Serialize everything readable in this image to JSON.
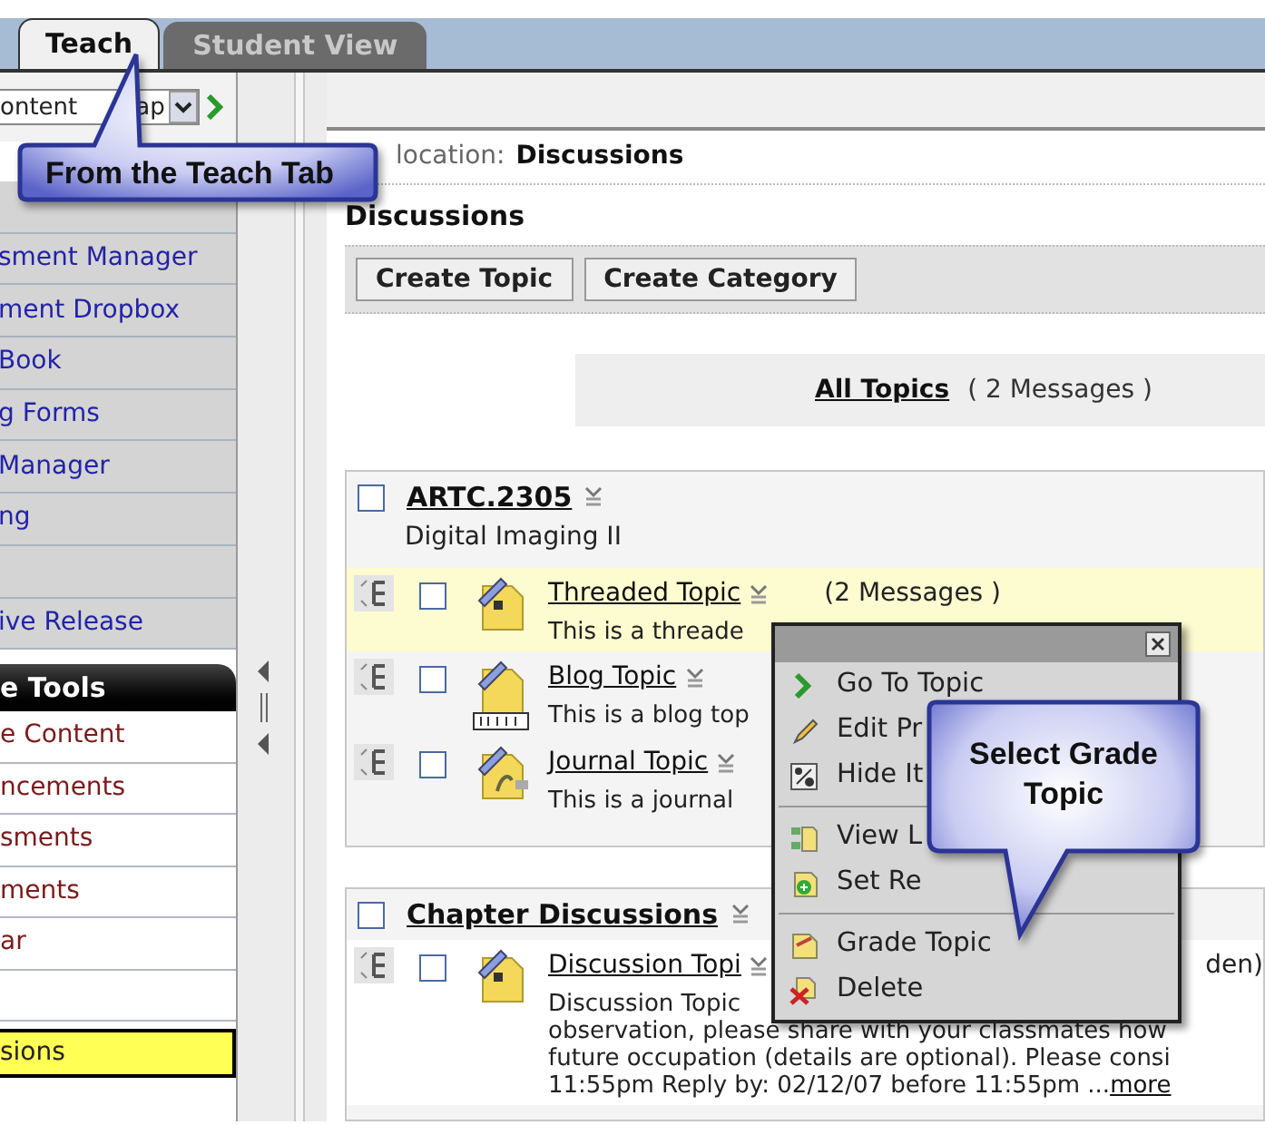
{
  "tabs": [
    {
      "label": "Teach",
      "selected": true
    },
    {
      "label": "Student View",
      "selected": false
    }
  ],
  "course_select": {
    "value_left": "ontent",
    "value_right": "ap"
  },
  "sidebar": {
    "items": [
      {
        "kind": "blank"
      },
      {
        "kind": "link",
        "label": "sment Manager"
      },
      {
        "kind": "link",
        "label": "ment Dropbox"
      },
      {
        "kind": "link",
        "label": "Book"
      },
      {
        "kind": "link",
        "label": "g Forms"
      },
      {
        "kind": "link",
        "label": "Manager"
      },
      {
        "kind": "link",
        "label": "ng"
      },
      {
        "kind": "blank"
      },
      {
        "kind": "link",
        "label": "ive Release"
      }
    ],
    "tools_header": "e Tools",
    "tools": [
      {
        "kind": "link",
        "label": "e Content",
        "selected": false
      },
      {
        "kind": "link",
        "label": "ncements",
        "selected": false
      },
      {
        "kind": "link",
        "label": "sments",
        "selected": false
      },
      {
        "kind": "link",
        "label": "ments",
        "selected": false
      },
      {
        "kind": "link",
        "label": "ar",
        "selected": false
      },
      {
        "kind": "blank",
        "selected": false
      },
      {
        "kind": "link",
        "label": "sions",
        "selected": true
      }
    ]
  },
  "location": {
    "label": "location:",
    "value": "Discussions"
  },
  "heading": "Discussions",
  "toolbar": [
    "Create Topic",
    "Create Category"
  ],
  "all_topics": {
    "link": "All Topics",
    "count": "( 2 Messages )"
  },
  "categories": [
    {
      "title": "ARTC.2305",
      "checked": false,
      "subtitle": "Digital Imaging II",
      "topics": [
        {
          "kind": "thread",
          "title": "Threaded Topic",
          "checked": false,
          "messages": "(2 Messages )",
          "highlighted": true,
          "description": [
            "This is a threade"
          ]
        },
        {
          "kind": "blog",
          "title": "Blog Topic",
          "checked": false,
          "highlighted": false,
          "description": [
            "This is a blog top"
          ]
        },
        {
          "kind": "journal",
          "title": "Journal Topic",
          "checked": false,
          "highlighted": false,
          "description": [
            "This is a journal"
          ]
        }
      ]
    },
    {
      "title": "Chapter Discussions",
      "checked": false,
      "topics": [
        {
          "kind": "thread",
          "title": "Discussion Topi",
          "checked": false,
          "suffix": "den)",
          "highlighted": false,
          "description": [
            "Discussion Topic",
            "observation, please share with your classmates how",
            "future occupation (details are optional). Please consi",
            "11:55pm Reply by: 02/12/07 before 11:55pm ..."
          ],
          "more_link": "more"
        }
      ]
    }
  ],
  "context_menu": {
    "items": [
      {
        "kind": "go",
        "label": "Go To Topic"
      },
      {
        "kind": "edit",
        "label": "Edit Pr"
      },
      {
        "kind": "hide",
        "label": "Hide It"
      },
      {
        "kind": "separator"
      },
      {
        "kind": "view",
        "label": "View L"
      },
      {
        "kind": "release",
        "label": "Set Re"
      },
      {
        "kind": "separator"
      },
      {
        "kind": "grade",
        "label": "Grade Topic"
      },
      {
        "kind": "delete",
        "label": "Delete"
      }
    ]
  },
  "callouts": [
    {
      "text": "From the Teach Tab"
    },
    {
      "text": "Select Grade Topic"
    }
  ]
}
